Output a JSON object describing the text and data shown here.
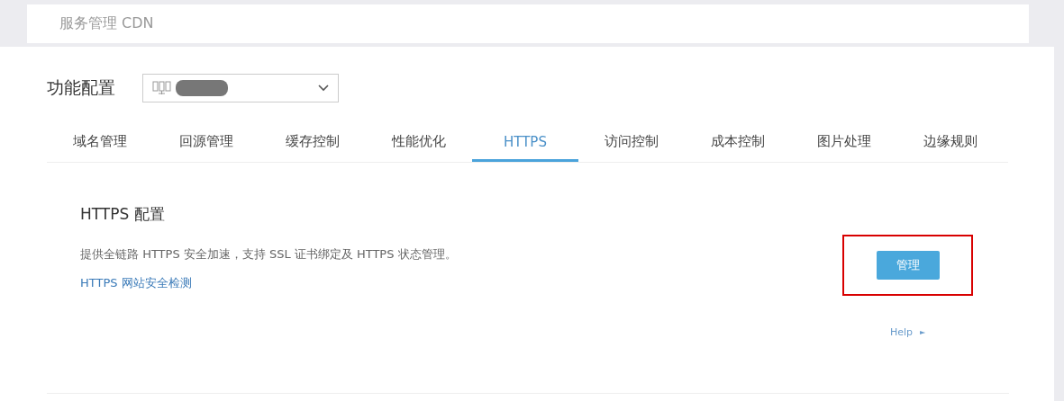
{
  "header": {
    "title": "服务管理 CDN"
  },
  "config": {
    "label": "功能配置",
    "select": {
      "value_redacted": true
    }
  },
  "tabs": [
    {
      "label": "域名管理",
      "selected": false
    },
    {
      "label": "回源管理",
      "selected": false
    },
    {
      "label": "缓存控制",
      "selected": false
    },
    {
      "label": "性能优化",
      "selected": false
    },
    {
      "label": "HTTPS",
      "selected": true
    },
    {
      "label": "访问控制",
      "selected": false
    },
    {
      "label": "成本控制",
      "selected": false
    },
    {
      "label": "图片处理",
      "selected": false
    },
    {
      "label": "边缘规则",
      "selected": false
    }
  ],
  "section": {
    "title": "HTTPS 配置",
    "description": "提供全链路 HTTPS 安全加速，支持 SSL 证书绑定及 HTTPS 状态管理。",
    "link": "HTTPS 网站安全检测",
    "button": {
      "label": "管理",
      "highlighted": true
    },
    "help": "Help",
    "help_arrow": "►"
  }
}
